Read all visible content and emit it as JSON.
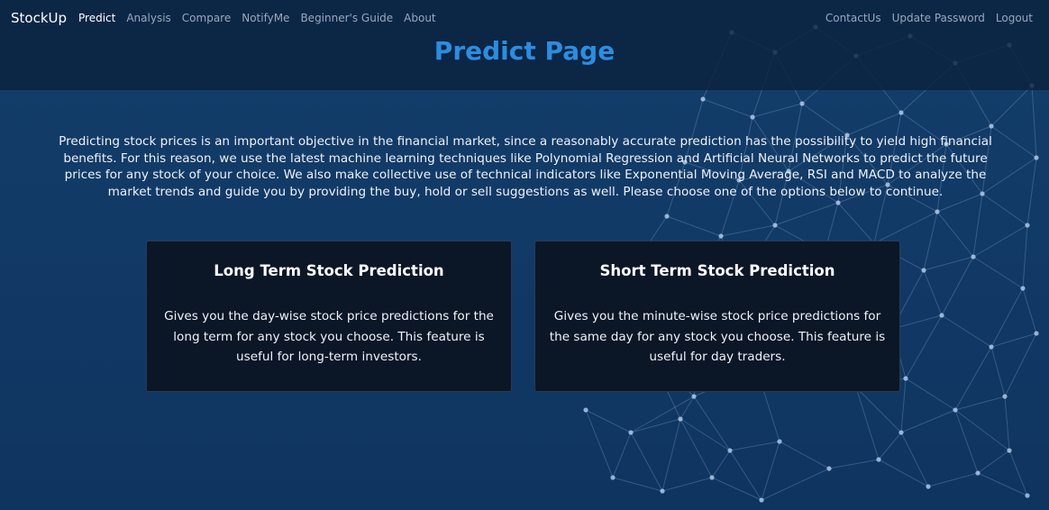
{
  "navbar": {
    "brand": "StockUp",
    "left_links": [
      "Predict",
      "Analysis",
      "Compare",
      "NotifyMe",
      "Beginner's Guide",
      "About"
    ],
    "right_links": [
      "ContactUs",
      "Update Password",
      "Logout"
    ],
    "active": "Predict"
  },
  "page": {
    "title": "Predict Page",
    "intro": "Predicting stock prices is an important objective in the financial market, since a reasonably accurate prediction has the possibility to yield high financial benefits. For this reason, we use the latest machine learning techniques like Polynomial Regression and Artificial Neural Networks to predict the future prices for any stock of your choice. We also make collective use of technical indicators like Exponential Moving Average, RSI and MACD to analyze the market trends and guide you by providing the buy, hold or sell suggestions as well. Please choose one of the options below to continue."
  },
  "cards": [
    {
      "title": "Long Term Stock Prediction",
      "description": "Gives you the day-wise stock price predictions for the long term for any stock you choose. This feature is useful for long-term investors."
    },
    {
      "title": "Short Term Stock Prediction",
      "description": "Gives you the minute-wise stock price predictions for the same day for any stock you choose. This feature is useful for day traders."
    }
  ],
  "colors": {
    "background": "#123a66",
    "header": "#0b213e",
    "title": "#2c8de0",
    "card": "#0b1627"
  }
}
